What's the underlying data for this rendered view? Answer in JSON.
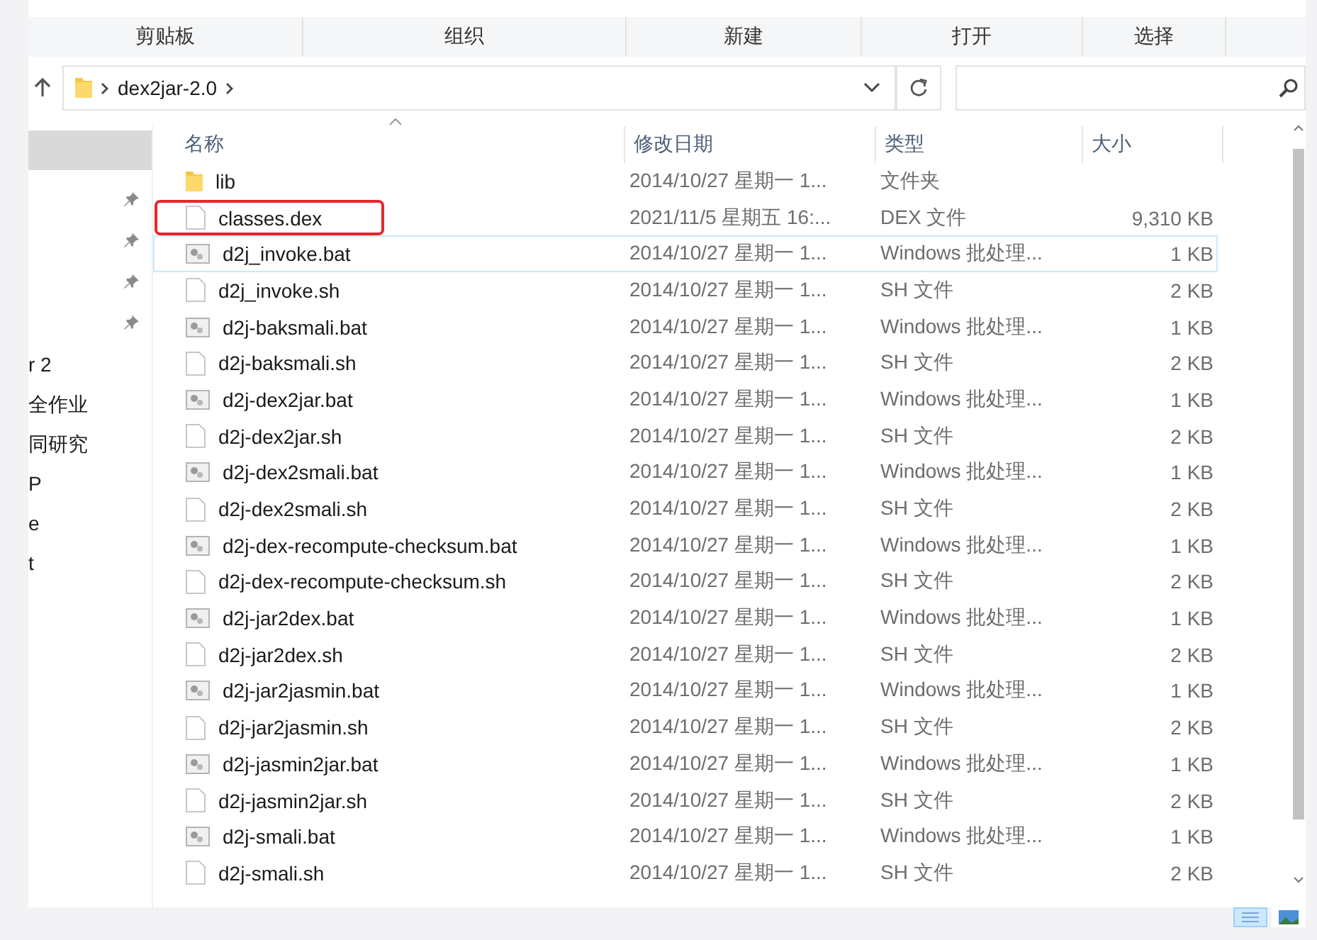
{
  "ribbon": {
    "groups": [
      "剪贴板",
      "组织",
      "新建",
      "打开",
      "选择"
    ]
  },
  "address_bar": {
    "path": [
      "dex2jar-2.0"
    ]
  },
  "navigation": {
    "pins": [
      {
        "pinned": true
      },
      {
        "pinned": true
      },
      {
        "pinned": true
      },
      {
        "pinned": true
      }
    ],
    "items": [
      "r 2",
      "全作业",
      "同研究",
      "P",
      "e",
      "t"
    ]
  },
  "table": {
    "columns": [
      {
        "label": "名称",
        "sorted": true
      },
      {
        "label": "修改日期",
        "sorted": false
      },
      {
        "label": "类型",
        "sorted": false
      },
      {
        "label": "大小",
        "sorted": false
      }
    ],
    "rows": [
      {
        "kind": "folder",
        "name": "lib",
        "date": "2014/10/27 星期一 1...",
        "type": "文件夹",
        "size": "",
        "outlined": false,
        "focused": false
      },
      {
        "kind": "file",
        "name": "classes.dex",
        "date": "2021/11/5 星期五 16:...",
        "type": "DEX 文件",
        "size": "9,310 KB",
        "outlined": true,
        "focused": false
      },
      {
        "kind": "bat",
        "name": "d2j_invoke.bat",
        "date": "2014/10/27 星期一 1...",
        "type": "Windows 批处理...",
        "size": "1 KB",
        "outlined": false,
        "focused": true
      },
      {
        "kind": "file",
        "name": "d2j_invoke.sh",
        "date": "2014/10/27 星期一 1...",
        "type": "SH 文件",
        "size": "2 KB",
        "outlined": false,
        "focused": false
      },
      {
        "kind": "bat",
        "name": "d2j-baksmali.bat",
        "date": "2014/10/27 星期一 1...",
        "type": "Windows 批处理...",
        "size": "1 KB",
        "outlined": false,
        "focused": false
      },
      {
        "kind": "file",
        "name": "d2j-baksmali.sh",
        "date": "2014/10/27 星期一 1...",
        "type": "SH 文件",
        "size": "2 KB",
        "outlined": false,
        "focused": false
      },
      {
        "kind": "bat",
        "name": "d2j-dex2jar.bat",
        "date": "2014/10/27 星期一 1...",
        "type": "Windows 批处理...",
        "size": "1 KB",
        "outlined": false,
        "focused": false
      },
      {
        "kind": "file",
        "name": "d2j-dex2jar.sh",
        "date": "2014/10/27 星期一 1...",
        "type": "SH 文件",
        "size": "2 KB",
        "outlined": false,
        "focused": false
      },
      {
        "kind": "bat",
        "name": "d2j-dex2smali.bat",
        "date": "2014/10/27 星期一 1...",
        "type": "Windows 批处理...",
        "size": "1 KB",
        "outlined": false,
        "focused": false
      },
      {
        "kind": "file",
        "name": "d2j-dex2smali.sh",
        "date": "2014/10/27 星期一 1...",
        "type": "SH 文件",
        "size": "2 KB",
        "outlined": false,
        "focused": false
      },
      {
        "kind": "bat",
        "name": "d2j-dex-recompute-checksum.bat",
        "date": "2014/10/27 星期一 1...",
        "type": "Windows 批处理...",
        "size": "1 KB",
        "outlined": false,
        "focused": false
      },
      {
        "kind": "file",
        "name": "d2j-dex-recompute-checksum.sh",
        "date": "2014/10/27 星期一 1...",
        "type": "SH 文件",
        "size": "2 KB",
        "outlined": false,
        "focused": false
      },
      {
        "kind": "bat",
        "name": "d2j-jar2dex.bat",
        "date": "2014/10/27 星期一 1...",
        "type": "Windows 批处理...",
        "size": "1 KB",
        "outlined": false,
        "focused": false
      },
      {
        "kind": "file",
        "name": "d2j-jar2dex.sh",
        "date": "2014/10/27 星期一 1...",
        "type": "SH 文件",
        "size": "2 KB",
        "outlined": false,
        "focused": false
      },
      {
        "kind": "bat",
        "name": "d2j-jar2jasmin.bat",
        "date": "2014/10/27 星期一 1...",
        "type": "Windows 批处理...",
        "size": "1 KB",
        "outlined": false,
        "focused": false
      },
      {
        "kind": "file",
        "name": "d2j-jar2jasmin.sh",
        "date": "2014/10/27 星期一 1...",
        "type": "SH 文件",
        "size": "2 KB",
        "outlined": false,
        "focused": false
      },
      {
        "kind": "bat",
        "name": "d2j-jasmin2jar.bat",
        "date": "2014/10/27 星期一 1...",
        "type": "Windows 批处理...",
        "size": "1 KB",
        "outlined": false,
        "focused": false
      },
      {
        "kind": "file",
        "name": "d2j-jasmin2jar.sh",
        "date": "2014/10/27 星期一 1...",
        "type": "SH 文件",
        "size": "2 KB",
        "outlined": false,
        "focused": false
      },
      {
        "kind": "bat",
        "name": "d2j-smali.bat",
        "date": "2014/10/27 星期一 1...",
        "type": "Windows 批处理...",
        "size": "1 KB",
        "outlined": false,
        "focused": false
      },
      {
        "kind": "file",
        "name": "d2j-smali.sh",
        "date": "2014/10/27 星期一 1...",
        "type": "SH 文件",
        "size": "2 KB",
        "outlined": false,
        "focused": false
      }
    ]
  },
  "view_buttons": [
    {
      "kind": "details",
      "selected": true
    },
    {
      "kind": "icons",
      "selected": false
    }
  ]
}
